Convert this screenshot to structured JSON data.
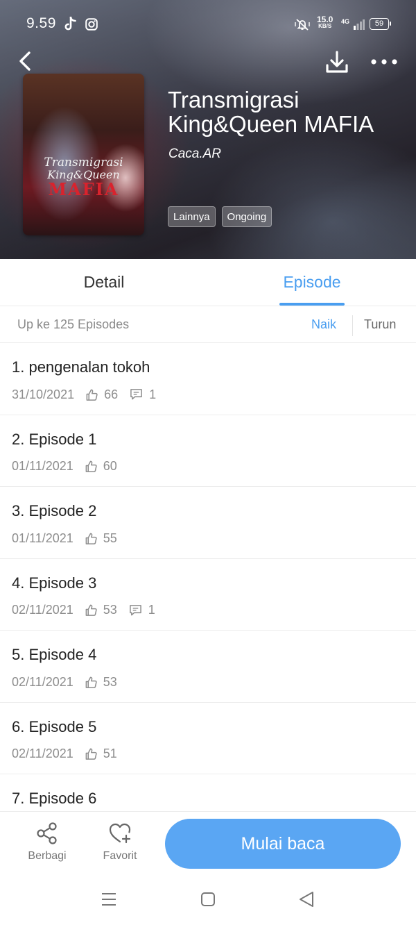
{
  "status_bar": {
    "time": "9.59",
    "speed_value": "15.0",
    "speed_unit": "KB/S",
    "network": "4G",
    "battery": "59"
  },
  "book": {
    "title": "Transmigrasi King&Queen MAFIA",
    "author": "Caca.AR",
    "tags": [
      "Lainnya",
      "Ongoing"
    ],
    "cover_lines": [
      "Transmigrasi",
      "King&Queen",
      "MAFIA"
    ]
  },
  "tabs": {
    "detail": "Detail",
    "episode": "Episode"
  },
  "sort": {
    "count_label": "Up ke 125 Episodes",
    "asc": "Naik",
    "desc": "Turun"
  },
  "episodes": [
    {
      "title": "1. pengenalan tokoh",
      "date": "31/10/2021",
      "likes": "66",
      "comments": "1"
    },
    {
      "title": "2. Episode 1",
      "date": "01/11/2021",
      "likes": "60",
      "comments": ""
    },
    {
      "title": "3. Episode 2",
      "date": "01/11/2021",
      "likes": "55",
      "comments": ""
    },
    {
      "title": "4. Episode 3",
      "date": "02/11/2021",
      "likes": "53",
      "comments": "1"
    },
    {
      "title": "5. Episode 4",
      "date": "02/11/2021",
      "likes": "53",
      "comments": ""
    },
    {
      "title": "6. Episode 5",
      "date": "02/11/2021",
      "likes": "51",
      "comments": ""
    },
    {
      "title": "7. Episode 6",
      "date": "",
      "likes": "",
      "comments": ""
    }
  ],
  "bottom_bar": {
    "share_label": "Berbagi",
    "favorite_label": "Favorit",
    "read_label": "Mulai baca"
  },
  "colors": {
    "accent": "#4a9ef0",
    "cta": "#5aa6f3",
    "muted_text": "#8d8d8d"
  },
  "icons": {
    "back": "chevron-left-icon",
    "download": "download-icon",
    "more": "more-horizontal-icon",
    "like": "thumbs-up-icon",
    "comment": "comment-icon",
    "share": "share-icon",
    "favorite": "heart-plus-icon"
  }
}
